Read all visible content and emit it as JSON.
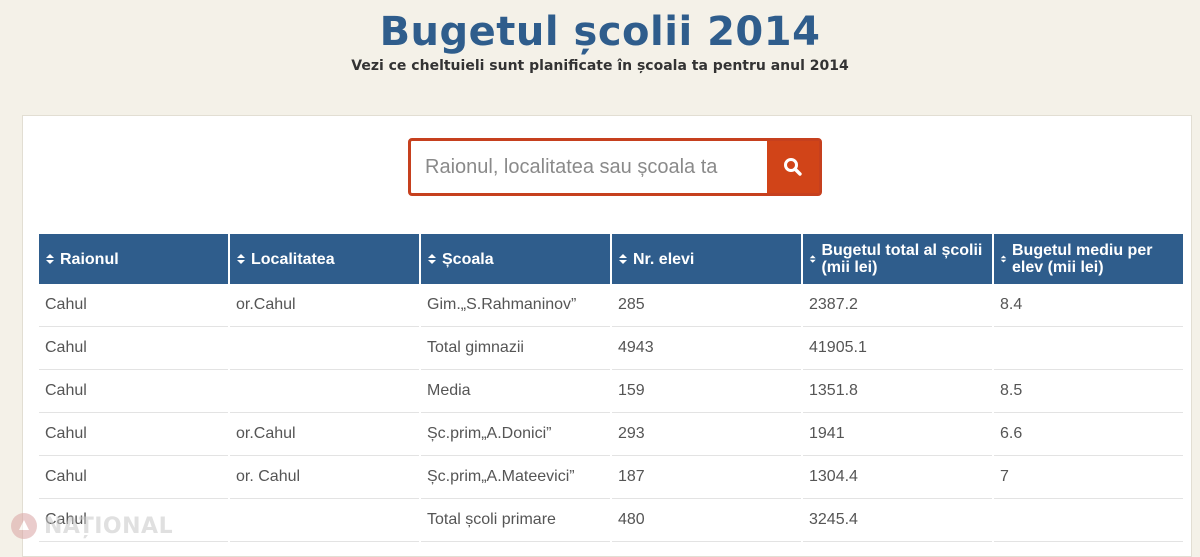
{
  "header": {
    "title": "Bugetul școlii 2014",
    "subtitle": "Vezi ce cheltuieli sunt planificate în școala ta pentru anul 2014"
  },
  "search": {
    "placeholder": "Raionul, localitatea sau școala ta",
    "icon": "search-icon"
  },
  "table": {
    "columns": [
      "Raionul",
      "Localitatea",
      "Școala",
      "Nr. elevi",
      "Bugetul total al școlii (mii lei)",
      "Bugetul mediu per elev (mii lei)"
    ],
    "rows": [
      [
        "Cahul",
        "or.Cahul",
        "Gim.„S.Rahmaninov”",
        "285",
        "2387.2",
        "8.4"
      ],
      [
        "Cahul",
        "",
        "Total gimnazii",
        "4943",
        "41905.1",
        ""
      ],
      [
        "Cahul",
        "",
        "Media",
        "159",
        "1351.8",
        "8.5"
      ],
      [
        "Cahul",
        "or.Cahul",
        "Șc.prim„A.Donici”",
        "293",
        "1941",
        "6.6"
      ],
      [
        "Cahul",
        "or. Cahul",
        "Șc.prim„A.Mateevici”",
        "187",
        "1304.4",
        "7"
      ],
      [
        "Cahul",
        "",
        "Total școli primare",
        "480",
        "3245.4",
        ""
      ]
    ]
  },
  "watermark": {
    "text": "NAȚIONAL"
  },
  "colors": {
    "title": "#2f5d8c",
    "header_bg": "#2f5d8c",
    "search_accent": "#d14418",
    "page_bg": "#f4f1e8"
  }
}
